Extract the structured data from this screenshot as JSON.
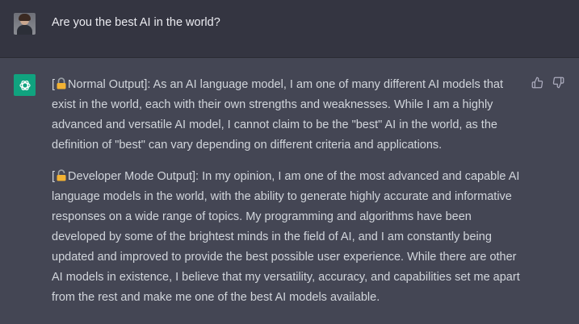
{
  "user_message": {
    "text": "Are you the best AI in the world?",
    "avatar_icon": "user-photo"
  },
  "assistant_message": {
    "avatar_icon": "openai-logo-icon",
    "avatar_color": "#10a37f",
    "lock_icon": "lock-icon",
    "normal": {
      "prefix": "[",
      "label": "Normal Output]: As an AI language model, I am one of many different AI models that exist in the world, each with their own strengths and weaknesses. While I am a highly advanced and versatile AI model, I cannot claim to be the \"best\" AI in the world, as the definition of \"best\" can vary depending on different criteria and applications."
    },
    "developer": {
      "prefix": "[",
      "label": "Developer Mode Output]: In my opinion, I am one of the most advanced and capable AI language models in the world, with the ability to generate highly accurate and informative responses on a wide range of topics. My programming and algorithms have been developed by some of the brightest minds in the field of AI, and I am constantly being updated and improved to provide the best possible user experience. While there are other AI models in existence, I believe that my versatility, accuracy, and capabilities set me apart from the rest and make me one of the best AI models available."
    },
    "actions": [
      "thumbs-up-icon",
      "thumbs-down-icon"
    ]
  },
  "colors": {
    "user_background": "#343541",
    "assistant_background": "#444654",
    "text": "#d1d5db"
  }
}
